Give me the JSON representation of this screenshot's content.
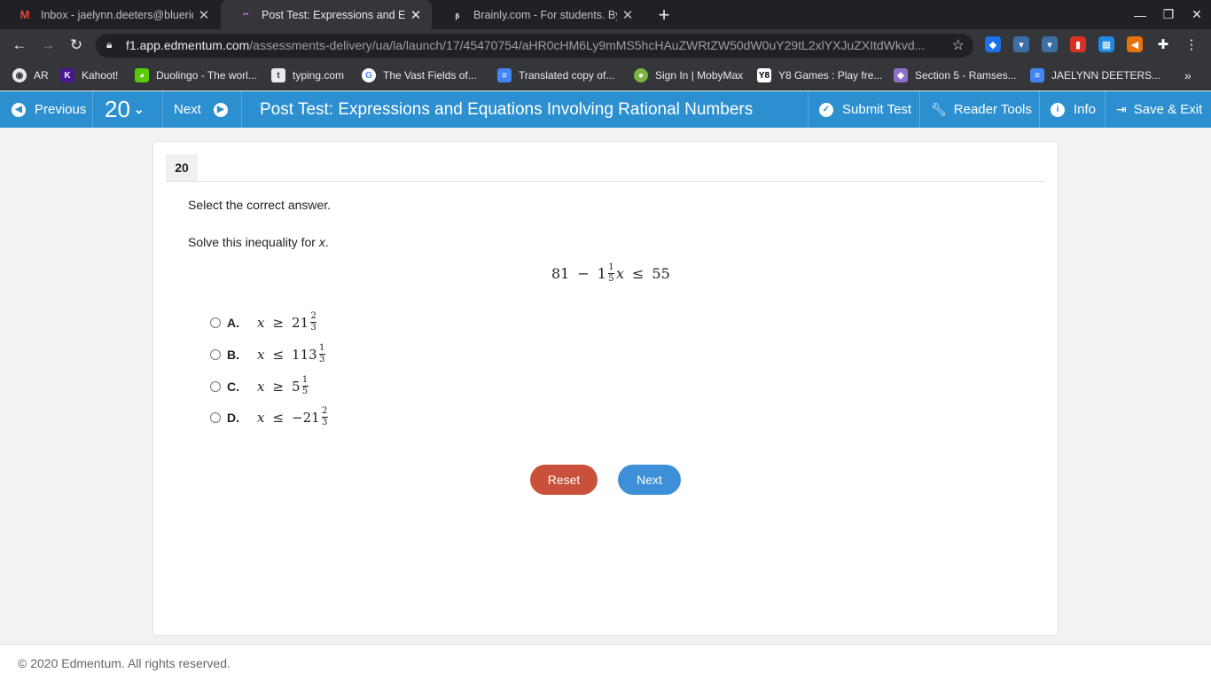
{
  "browser": {
    "tabs": [
      {
        "title": "Inbox - jaelynn.deeters@blueridg",
        "icon": "gmail-icon"
      },
      {
        "title": "Post Test: Expressions and Equa",
        "icon": "edmentum-icon"
      },
      {
        "title": "Brainly.com - For students. By st",
        "icon": "brainly-icon"
      }
    ],
    "url_host": "f1.app.edmentum.com",
    "url_path": "/assessments-delivery/ua/la/launch/17/45470754/aHR0cHM6Ly9mMS5hcHAuZWRtZW50dW0uY29tL2xlYXJuZXItdWkvd...",
    "bookmarks": [
      "AR",
      "Kahoot!",
      "Duolingo - The worl...",
      "typing.com",
      "The Vast Fields of...",
      "Translated copy of...",
      "Sign In | MobyMax",
      "Y8 Games : Play fre...",
      "Section 5 - Ramses...",
      "JAELYNN DEETERS..."
    ]
  },
  "appbar": {
    "previous_label": "Previous",
    "question_number": "20",
    "next_label": "Next",
    "test_title": "Post Test: Expressions and Equations Involving Rational Numbers",
    "submit_label": "Submit Test",
    "reader_tools_label": "Reader Tools",
    "info_label": "Info",
    "save_exit_label": "Save & Exit"
  },
  "question": {
    "number": "20",
    "instruction": "Select the correct answer.",
    "prompt_text": "Solve this inequality for ",
    "prompt_var": "x",
    "prompt_end": ".",
    "inequality": {
      "a": "81",
      "minus": "−",
      "whole": "1",
      "num": "1",
      "den": "5",
      "var": "x",
      "op": "≤",
      "rhs": "55"
    },
    "options": [
      {
        "letter": "A.",
        "var": "x",
        "op": "≥",
        "whole": "21",
        "num": "2",
        "den": "3"
      },
      {
        "letter": "B.",
        "var": "x",
        "op": "≤",
        "whole": "113",
        "num": "1",
        "den": "3"
      },
      {
        "letter": "C.",
        "var": "x",
        "op": "≥",
        "whole": "5",
        "num": "1",
        "den": "5"
      },
      {
        "letter": "D.",
        "var": "x",
        "op": "≤",
        "whole": "−21",
        "num": "2",
        "den": "3"
      }
    ],
    "reset_label": "Reset",
    "next_label": "Next"
  },
  "footer": {
    "copyright": "© 2020 Edmentum. All rights reserved."
  },
  "colors": {
    "appbar": "#2c8fd0",
    "reset": "#c9503a",
    "next": "#3d8fd8"
  }
}
